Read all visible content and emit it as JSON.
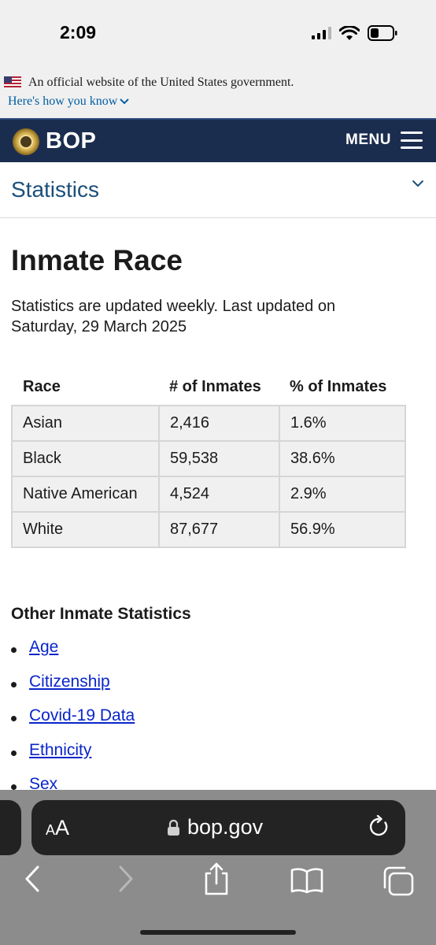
{
  "status_bar": {
    "time": "2:09"
  },
  "gov_banner": {
    "text": "An official website of the United States government.",
    "link": "Here's how you know"
  },
  "header": {
    "brand": "BOP",
    "menu_label": "MENU"
  },
  "section_nav": {
    "label": "Statistics"
  },
  "page": {
    "title": "Inmate Race",
    "updated_line1": "Statistics are updated weekly. Last updated on",
    "updated_line2": "Saturday, 29 March 2025"
  },
  "table": {
    "headers": [
      "Race",
      "# of Inmates",
      "% of Inmates"
    ],
    "rows": [
      {
        "race": "Asian",
        "count": "2,416",
        "pct": "1.6%"
      },
      {
        "race": "Black",
        "count": "59,538",
        "pct": "38.6%"
      },
      {
        "race": "Native American",
        "count": "4,524",
        "pct": "2.9%"
      },
      {
        "race": "White",
        "count": "87,677",
        "pct": "56.9%"
      }
    ]
  },
  "other": {
    "title": "Other Inmate Statistics",
    "links": [
      "Age",
      "Citizenship",
      "Covid-19 Data",
      "Ethnicity",
      "Sex"
    ]
  },
  "browser": {
    "aa_label_small": "A",
    "aa_label_large": "A",
    "url": "bop.gov"
  },
  "colors": {
    "header_bg": "#1b2d4f",
    "link": "#0a25c9",
    "section_label": "#1b4f7a",
    "banner_link": "#005ea2"
  }
}
